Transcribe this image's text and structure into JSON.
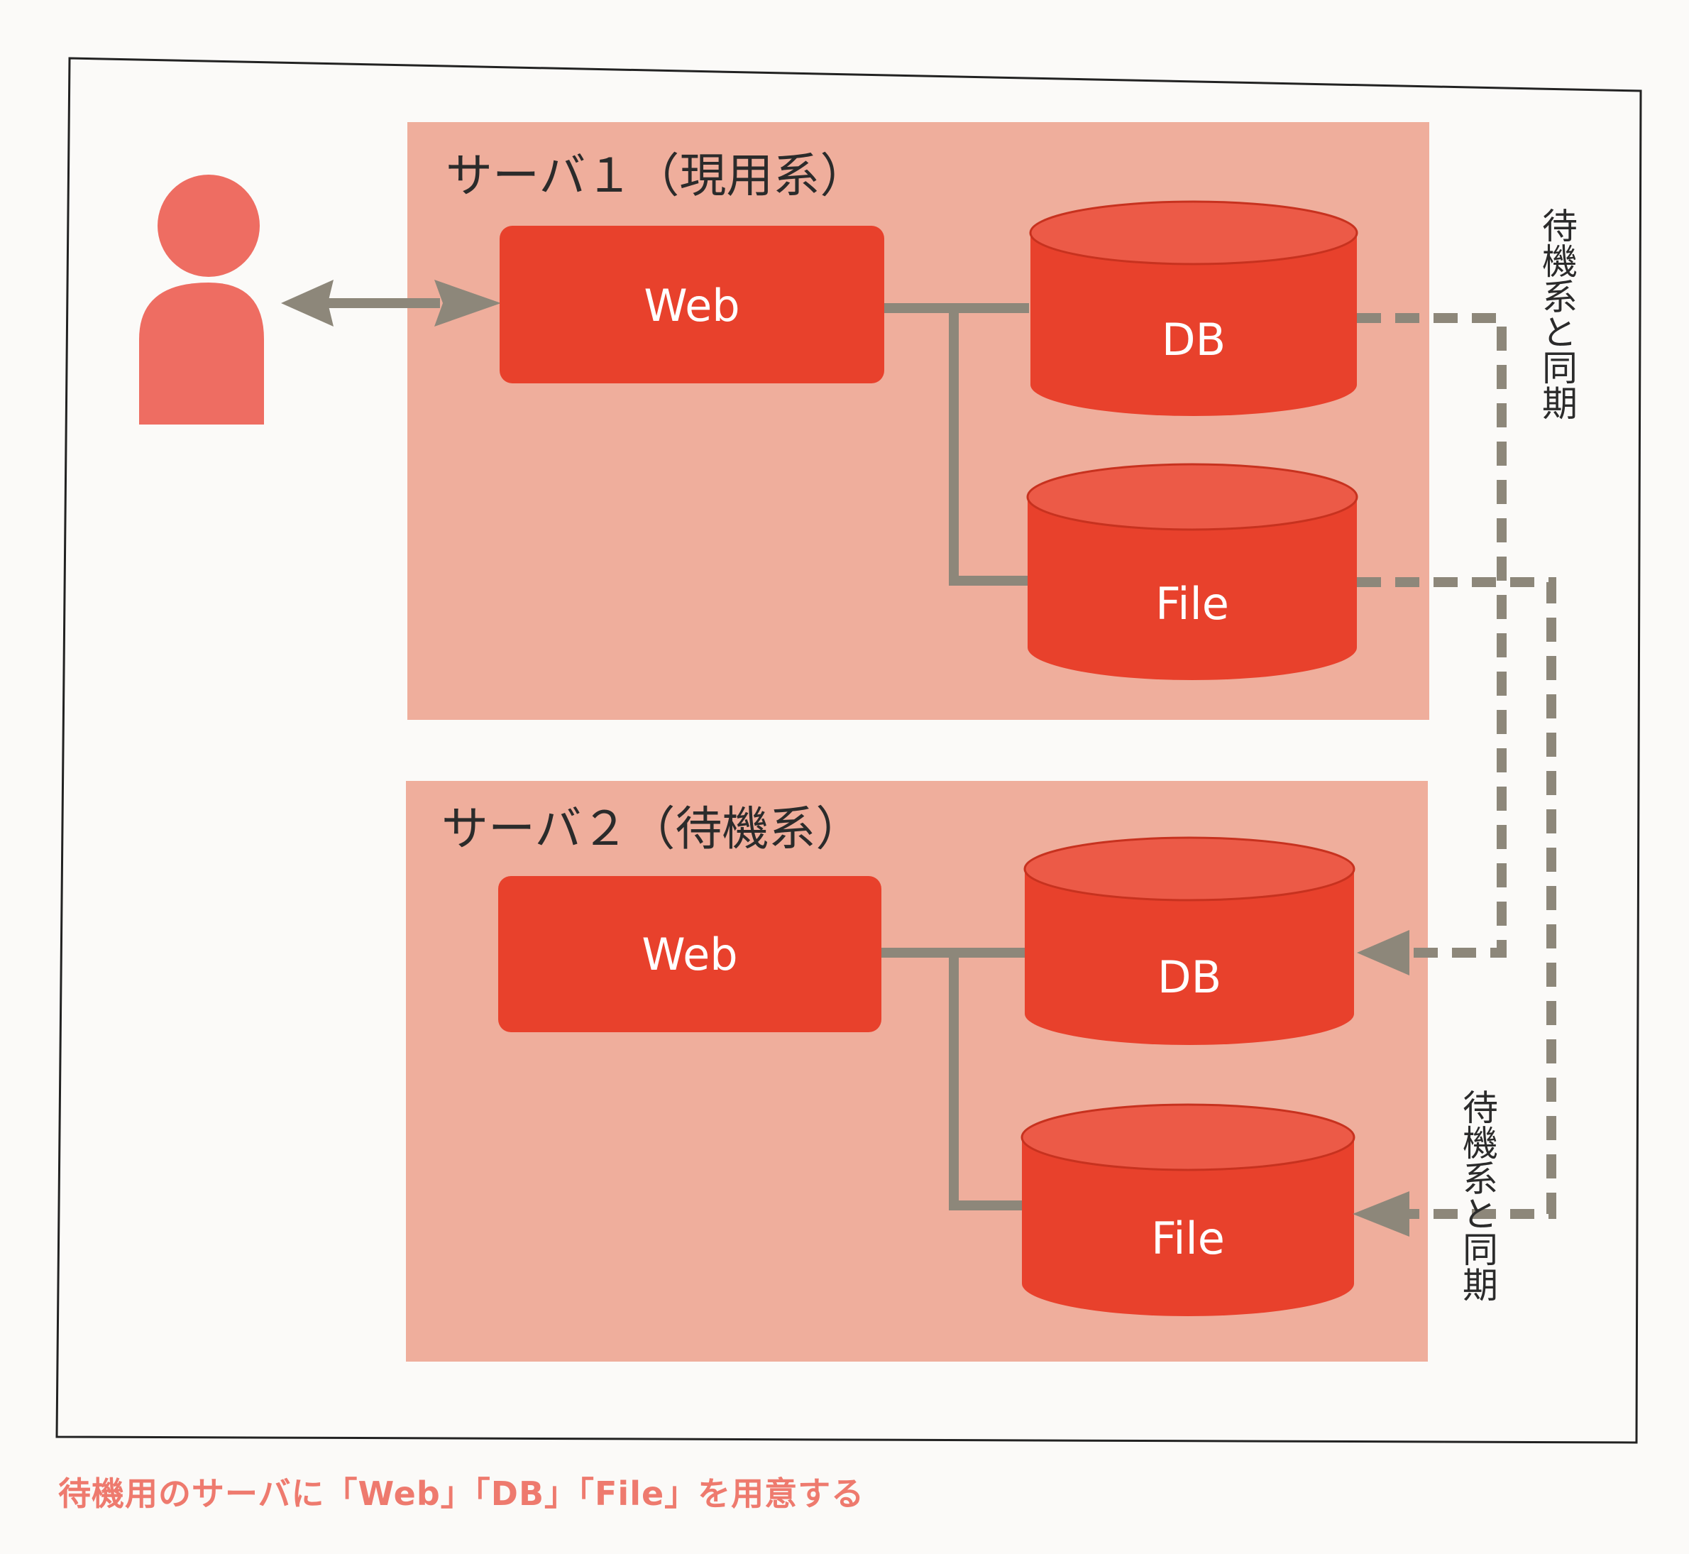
{
  "colors": {
    "server_bg": "#efae9c",
    "node_fill": "#e8412c",
    "node_top": "#ec5a47",
    "user": "#ee6d62",
    "connector": "#8d877a",
    "caption": "#ee7a6e",
    "frame": "#222222"
  },
  "icons": {
    "user": "person-icon"
  },
  "server1": {
    "title": "サーバ１（現用系）",
    "web_label": "Web",
    "db_label": "DB",
    "file_label": "File"
  },
  "server2": {
    "title": "サーバ２（待機系）",
    "web_label": "Web",
    "db_label": "DB",
    "file_label": "File"
  },
  "sync_labels": [
    "待機系と同期",
    "待機系と同期"
  ],
  "caption": "待機用のサーバに「Web」「DB」「File」を用意する"
}
